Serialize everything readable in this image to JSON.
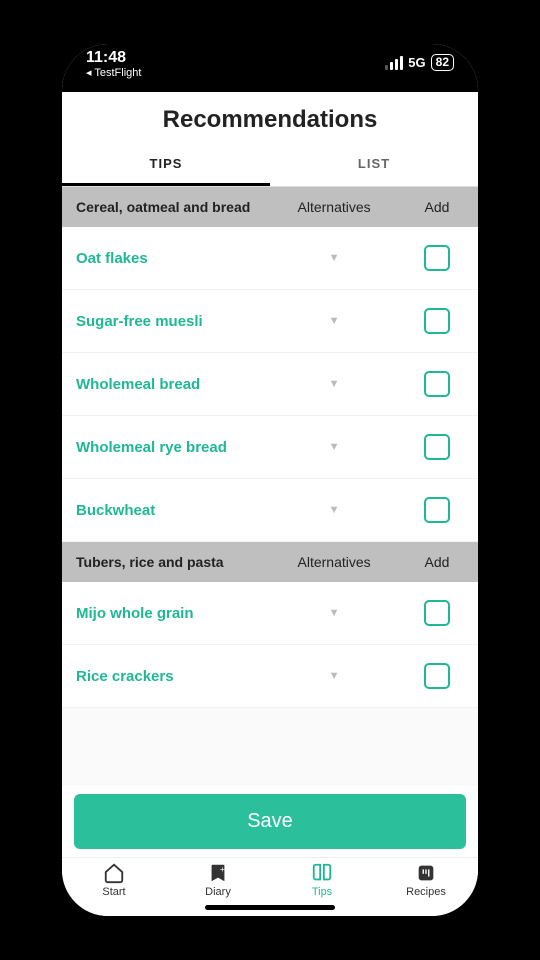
{
  "status_bar": {
    "time": "11:48",
    "back_app": "◂ TestFlight",
    "network": "5G",
    "battery": "82"
  },
  "header": {
    "title": "Recommendations"
  },
  "tabs": {
    "tips": "TIPS",
    "list": "LIST",
    "active": "tips"
  },
  "columns": {
    "alternatives": "Alternatives",
    "add": "Add"
  },
  "sections": [
    {
      "title": "Cereal, oatmeal and bread",
      "items": [
        {
          "name": "Oat flakes"
        },
        {
          "name": "Sugar-free muesli"
        },
        {
          "name": "Wholemeal bread"
        },
        {
          "name": "Wholemeal rye bread"
        },
        {
          "name": "Buckwheat"
        }
      ]
    },
    {
      "title": "Tubers, rice and pasta",
      "items": [
        {
          "name": "Mijo whole grain"
        },
        {
          "name": "Rice crackers"
        }
      ]
    }
  ],
  "save_label": "Save",
  "bottom_nav": {
    "start": "Start",
    "diary": "Diary",
    "tips": "Tips",
    "recipes": "Recipes",
    "active": "tips"
  }
}
